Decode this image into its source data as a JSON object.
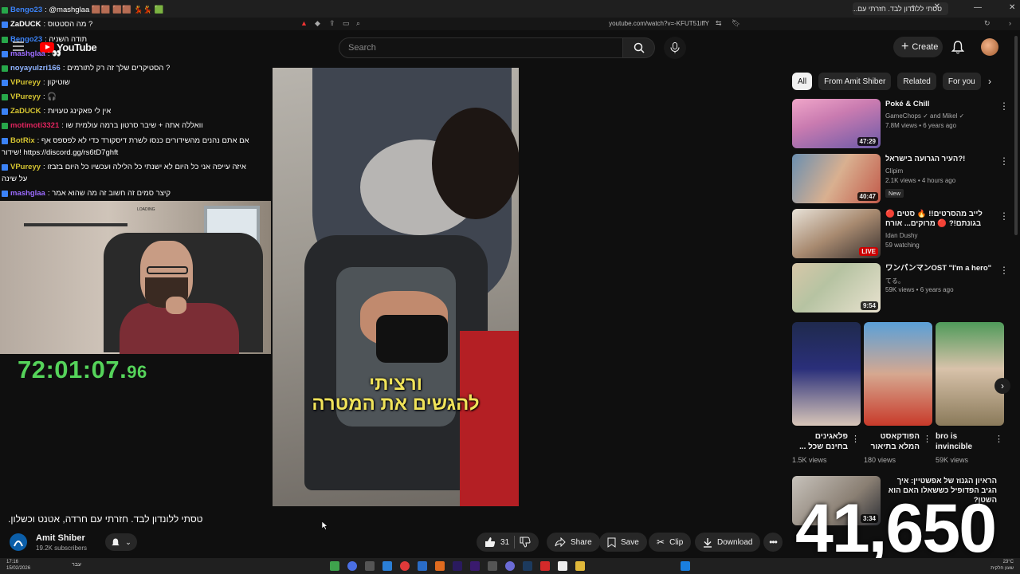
{
  "browser": {
    "tab_title": "טסתי ללונדון לבד. חזרתי עם...",
    "url": "youtube.com/watch?v=-KFUT51iffY"
  },
  "masthead": {
    "logo_text": "YouTube",
    "search_placeholder": "Search",
    "create_label": "Create"
  },
  "chat": [
    {
      "user": "Bengo23",
      "user_color": "#3b82f6",
      "msg": ": @mashglaa 🟫🟫 🟫🟫 💃💃 🟩"
    },
    {
      "user": "ZaDUCK",
      "user_color": "#ffffff",
      "msg": ": מה הסטטוס ?"
    },
    {
      "user": "Bengo23",
      "user_color": "#3b82f6",
      "msg": ": תודה השניה"
    },
    {
      "user": "mashglaa",
      "user_color": "#9b6bff",
      "msg": ": 👀"
    },
    {
      "user": "noyayulzri166",
      "user_color": "#8fb3ff",
      "msg": ": הסטיקרים שלך זה רק לתורמים ?"
    },
    {
      "user": "VPureyy",
      "user_color": "#d6c531",
      "msg": ": שוטיקון"
    },
    {
      "user": "VPureyy",
      "user_color": "#d6c531",
      "msg": ": 🎧"
    },
    {
      "user": "ZaDUCK",
      "user_color": "#d6c531",
      "msg": ": אין לי פאקינג טעויות"
    },
    {
      "user": "motimoti3321",
      "user_color": "#e0245e",
      "msg": ": וואללה אתה + שיבר סרטון ברמה עולמית שו"
    },
    {
      "user": "BotRix",
      "user_color": "#d6c531",
      "msg": ": אם אתם נהנים מהשידורים כנסו לשרת דיסקורד כדי לא לפספס אף"
    },
    {
      "user": "",
      "user_color": "#ffffff",
      "msg": "שידור! https://discord.gg/rs6tD7ghft"
    },
    {
      "user": "VPureyy",
      "user_color": "#d6c531",
      "msg": ": איזה עייפה אני כל היום לא ישנתי כל הלילה ועכשיו כל היום בזבזו"
    },
    {
      "user": "",
      "user_color": "#ffffff",
      "msg": "על שינה"
    },
    {
      "user": "mashglaa",
      "user_color": "#9b6bff",
      "msg": ": קיצר סמים זה חשוב זה מה שהוא אמר"
    }
  ],
  "webcam": {
    "loading_text": "LOADING"
  },
  "stream_timer": {
    "main": "72:01:07.",
    "fraction": "96"
  },
  "video": {
    "subtitle_line1": "ורציתי",
    "subtitle_line2": "להגשים את המטרה",
    "title": "טסתי ללונדון לבד. חזרתי עם חרדה, אטנט וכשלון.",
    "channel": "Amit Shiber",
    "subscribers": "19.2K subscribers",
    "likes": "31",
    "share_label": "Share",
    "save_label": "Save",
    "clip_label": "Clip",
    "download_label": "Download"
  },
  "chips": [
    "All",
    "From Amit Shiber",
    "Related",
    "For you"
  ],
  "recommendations": [
    {
      "title": "Poké & Chill",
      "channel": "GameChops ✓ and Mikel ✓",
      "meta": "7.8M views • 6 years ago",
      "duration": "47:29",
      "badge": ""
    },
    {
      "title": "העיר הגרועה בישראל?!",
      "channel": "Clipim",
      "meta": "2.1K views • 4 hours ago",
      "duration": "40:47",
      "badge": "New"
    },
    {
      "title": "לייב מהסרטים!! 🔥 סטים 🔴 בגונתם!? 🔴 מרוקים... אורח",
      "channel": "Idan Dushy",
      "meta": "59 watching",
      "duration": "LIVE",
      "badge": ""
    },
    {
      "title": "ワンパンマンOST \"I'm a hero\"",
      "channel": "てる。",
      "meta": "59K views • 6 years ago",
      "duration": "9:54",
      "badge": ""
    }
  ],
  "shorts": [
    {
      "title": "פלאגינים בחינם שכל ...",
      "views": "1.5K views"
    },
    {
      "title": "הפודקאסט המלא בתיאור",
      "views": "180 views"
    },
    {
      "title": "bro is invincible",
      "views": "59K views"
    }
  ],
  "last_rec": {
    "title": "הראיון הגנוז של אפשטיין: איך הגיב הפדופיל כששאלו האם הוא השטן?",
    "duration": "3:34"
  },
  "counter_overlay": "41,650",
  "taskbar": {
    "time": "17:16",
    "date": "15/02/2026",
    "lang": "עבר",
    "weather": "23°C",
    "weather_desc": "שעון חלקית"
  }
}
